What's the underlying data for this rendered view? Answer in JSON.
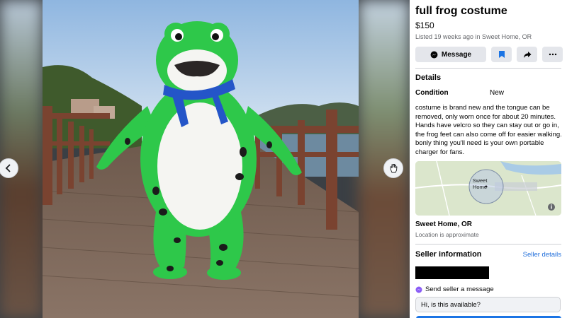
{
  "listing": {
    "title": "full frog costume",
    "price": "$150",
    "listed": "Listed 19 weeks ago in Sweet Home, OR"
  },
  "actions": {
    "message_label": "Message"
  },
  "details": {
    "heading": "Details",
    "condition_label": "Condition",
    "condition_value": "New",
    "description": "costume is brand new and the tongue can be removed, only worn once for about 20 minutes. Hands have velcro so they can stay out or go in, the frog feet can also come off for easier walking. bonly thing you'll need is your own portable charger for fans."
  },
  "location": {
    "map_label": "Sweet Home",
    "city": "Sweet Home, OR",
    "note": "Location is approximate"
  },
  "seller": {
    "heading": "Seller information",
    "details_link": "Seller details",
    "send_label": "Send seller a message",
    "message_value": "Hi, is this available?"
  },
  "colors": {
    "accent": "#1b74e4",
    "link": "#216fdb",
    "button_bg": "#e4e6eb",
    "frog_green": "#2ec84a"
  },
  "icons": [
    "chevron-left-icon",
    "hand-cursor-icon",
    "messenger-icon",
    "bookmark-icon",
    "share-icon",
    "more-icon",
    "info-icon"
  ]
}
